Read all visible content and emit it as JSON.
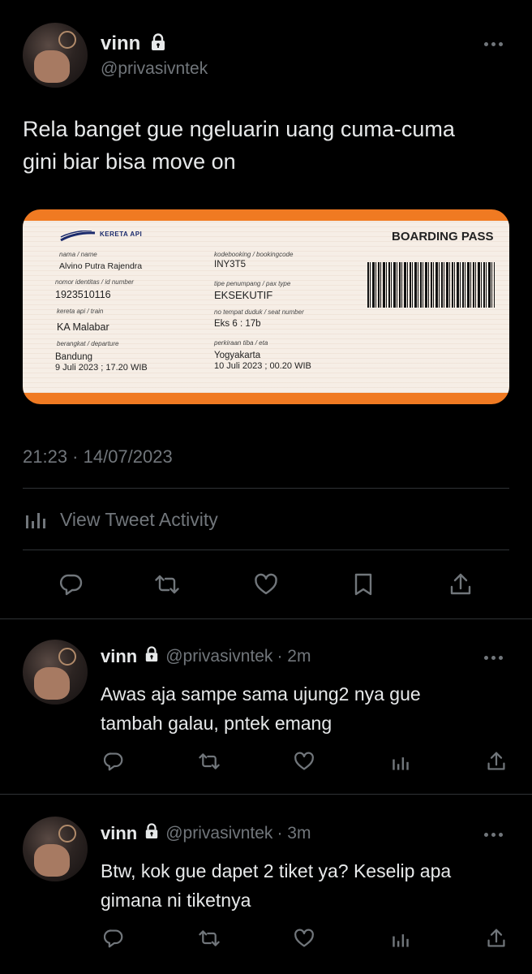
{
  "main_tweet": {
    "name": "vinn",
    "handle": "@privasivntek",
    "text_line1": "Rela banget gue ngeluarin uang cuma-cuma",
    "text_line2": "gini biar bisa move on",
    "timestamp": "21:23 · 14/07/2023",
    "activity_label": "View Tweet Activity"
  },
  "ticket": {
    "brand": "KERETA API",
    "title": "BOARDING PASS",
    "name_label": "nama / name",
    "name_value": "Alvino Putra Rajendra",
    "id_label": "nomor identitas / id number",
    "id_value": "1923510116",
    "train_label": "kereta api / train",
    "train_value": "KA Malabar",
    "departure_label": "berangkat / departure",
    "departure_city": "Bandung",
    "departure_time": "9 Juli 2023 ; 17.20 WIB",
    "booking_label": "kodebooking / bookingcode",
    "booking_value": "INY3T5",
    "pax_label": "tipe penumpang / pax type",
    "pax_value": "EKSEKUTIF",
    "seat_label": "no tempat duduk / seat number",
    "seat_value": "Eks 6 : 17b",
    "eta_label": "perkiraan tiba / eta",
    "eta_city": "Yogyakarta",
    "eta_time": "10 Juli 2023 ; 00.20 WIB"
  },
  "replies": [
    {
      "name": "vinn",
      "handle": "@privasivntek",
      "time": "· 2m",
      "text_line1": "Awas aja sampe sama ujung2 nya gue",
      "text_line2": "tambah galau, pntek emang"
    },
    {
      "name": "vinn",
      "handle": "@privasivntek",
      "time": "· 3m",
      "text_line1": "Btw, kok gue dapet 2 tiket ya? Keselip apa",
      "text_line2": "gimana ni tiketnya"
    }
  ],
  "icons": {
    "reply": "reply-icon",
    "retweet": "retweet-icon",
    "like": "like-icon",
    "bookmark": "bookmark-icon",
    "share": "share-icon",
    "analytics": "analytics-icon",
    "lock": "lock-icon",
    "more": "more-icon"
  },
  "colors": {
    "background": "#000000",
    "text": "#e7e9ea",
    "muted": "#71767b",
    "divider": "#2f3336",
    "ticket_orange": "#f07a22"
  }
}
